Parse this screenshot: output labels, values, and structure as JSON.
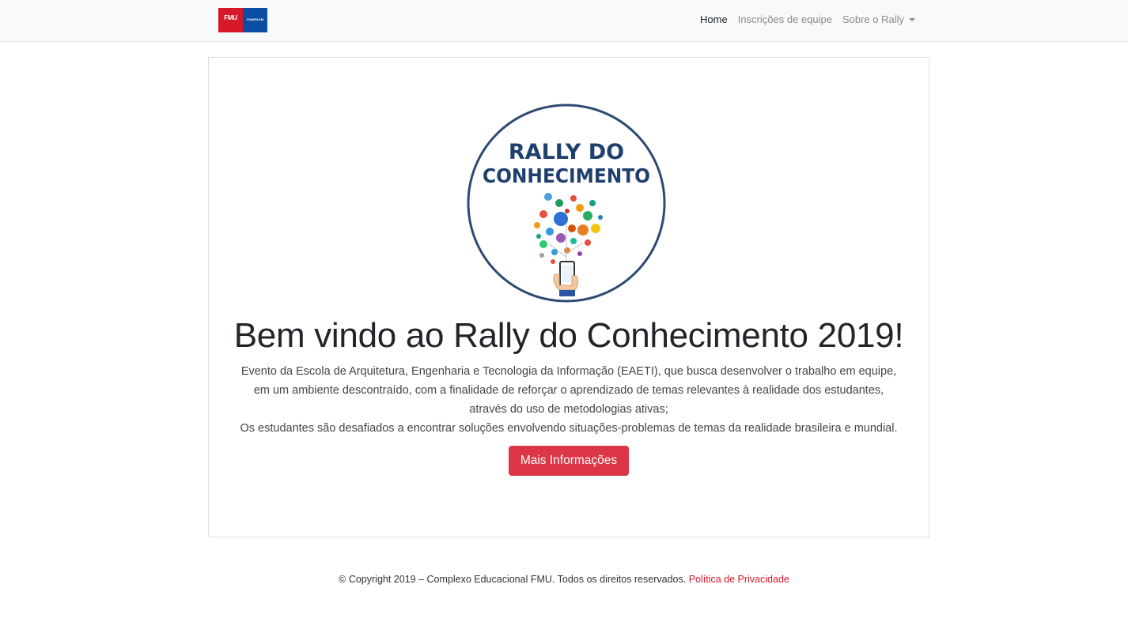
{
  "brand": {
    "left_text": "FMU",
    "right_text": "FIAMFAAM",
    "colors": {
      "red": "#d7182a",
      "blue": "#0b4ea2"
    }
  },
  "nav": {
    "items": [
      {
        "label": "Home",
        "active": true
      },
      {
        "label": "Inscrições de equipe",
        "active": false
      },
      {
        "label": "Sobre o Rally",
        "active": false,
        "dropdown": true
      }
    ]
  },
  "hero": {
    "logo_line1": "RALLY DO",
    "logo_line2": "CONHECIMENTO",
    "title": "Bem vindo ao Rally do Conhecimento 2019!",
    "paragraph_lines": [
      "Evento da Escola de Arquitetura, Engenharia e Tecnologia da Informação (EAETI), que busca desenvolver o trabalho em equipe,",
      "em um ambiente descontraído, com a finalidade de reforçar o aprendizado de temas relevantes à realidade dos estudantes,",
      "através do uso de metodologias ativas;",
      "Os estudantes são desafiados a encontrar soluções envolvendo situações-problemas de temas da realidade brasileira e mundial."
    ],
    "button_label": "Mais Informações",
    "button_color": "#dc3545"
  },
  "footer": {
    "copyright": "© Copyright 2019 – Complexo Educacional FMU. Todos os direitos reservados.",
    "privacy_link": "Política de Privacidade"
  }
}
